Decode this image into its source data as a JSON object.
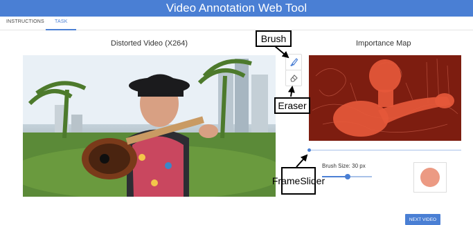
{
  "app": {
    "title": "Video Annotation Web Tool"
  },
  "tabs": [
    {
      "label": "INSTRUCTIONS",
      "active": false
    },
    {
      "label": "TASK",
      "active": true
    }
  ],
  "panels": {
    "video_title": "Distorted Video (X264)",
    "map_title": "Importance Map"
  },
  "tools": [
    {
      "name": "brush",
      "icon": "brush-icon"
    },
    {
      "name": "eraser",
      "icon": "eraser-icon"
    }
  ],
  "callouts": {
    "brush": "Brush",
    "eraser": "Eraser",
    "frame_slider_line1": "Frame",
    "frame_slider_line2": "Slider"
  },
  "controls": {
    "brush_size_label": "Brush Size: 30 px",
    "brush_size_fraction": 0.52,
    "frame_position_fraction": 0.0,
    "next_button": "NEXT VIDEO"
  },
  "colors": {
    "primary": "#4a7fd4",
    "map_background": "#7d1d10",
    "map_highlight": "#e5583a",
    "brush_preview": "#ec9a83"
  }
}
